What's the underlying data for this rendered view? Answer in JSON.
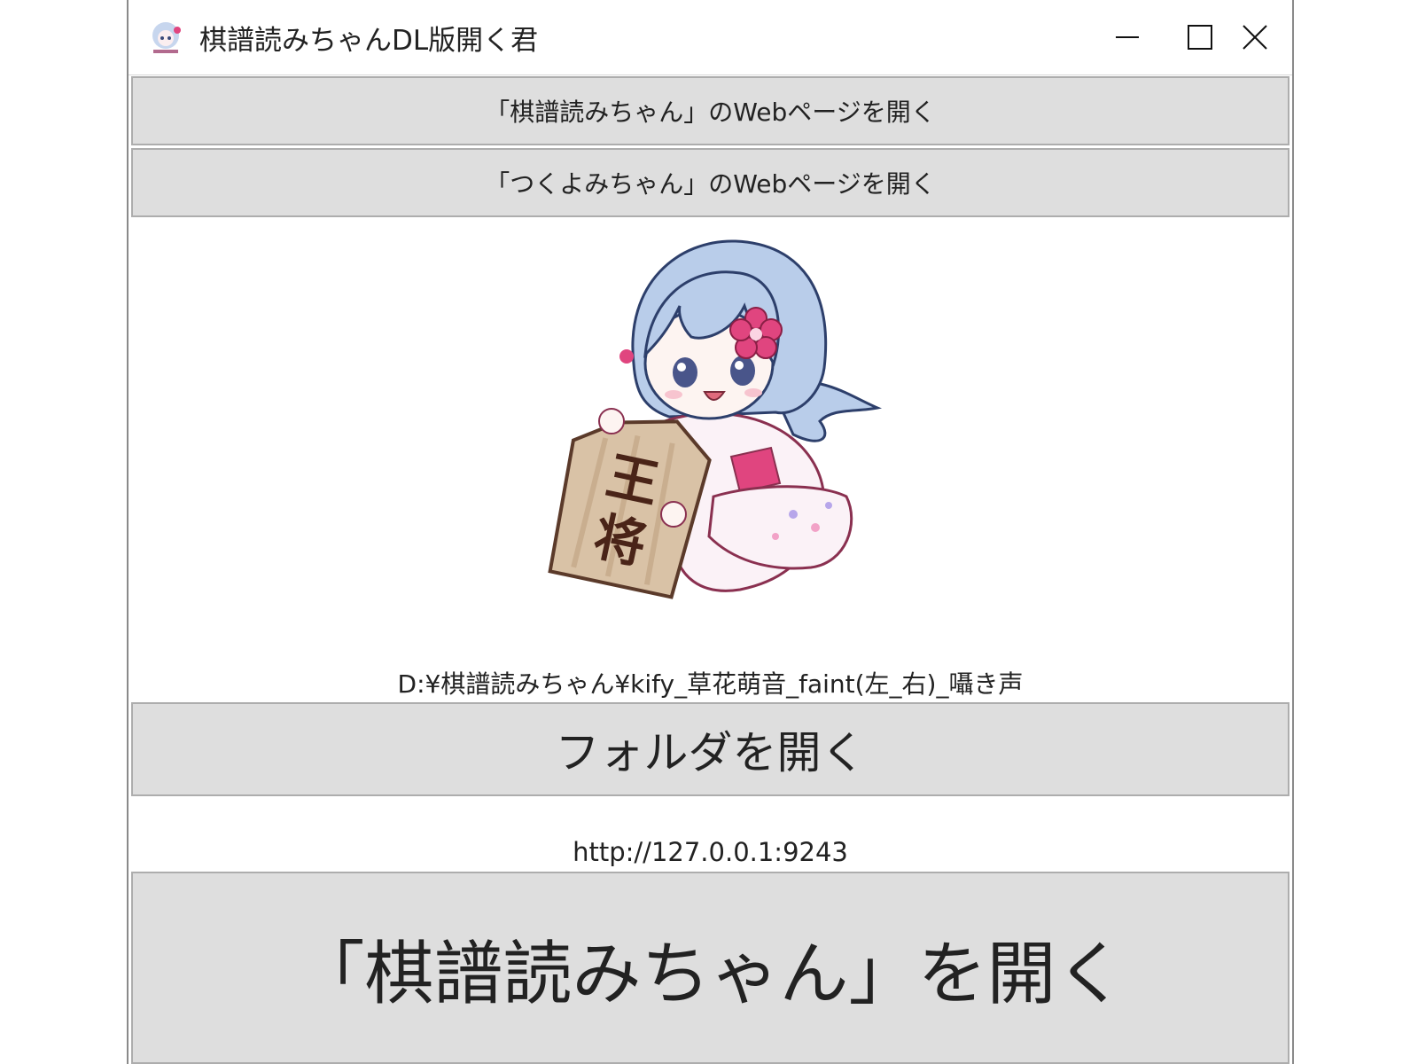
{
  "window": {
    "title": "棋譜読みちゃんDL版開く君",
    "icon": "tsukuyomi-app-icon",
    "controls": {
      "minimize": "minimize-icon",
      "maximize": "maximize-icon",
      "close": "close-icon"
    }
  },
  "buttons": {
    "open_kifu_web": "「棋譜読みちゃん」のWebページを開く",
    "open_tsukuyomi_web": "「つくよみちゃん」のWebページを開く",
    "open_folder": "フォルダを開く",
    "open_app": "「棋譜読みちゃん」を開く"
  },
  "illustration": {
    "subject": "character-holding-ousho-piece",
    "piece_text": "王将"
  },
  "folder_path": "D:¥棋譜読みちゃん¥kify_草花萌音_faint(左_右)_囁き声",
  "server_url": "http://127.0.0.1:9243",
  "colors": {
    "button_bg": "#dedede",
    "button_border": "#adadad",
    "window_bg": "#ffffff",
    "hair": "#b9cdea",
    "flower": "#e0457f",
    "piece_wood": "#d9c2a6"
  }
}
